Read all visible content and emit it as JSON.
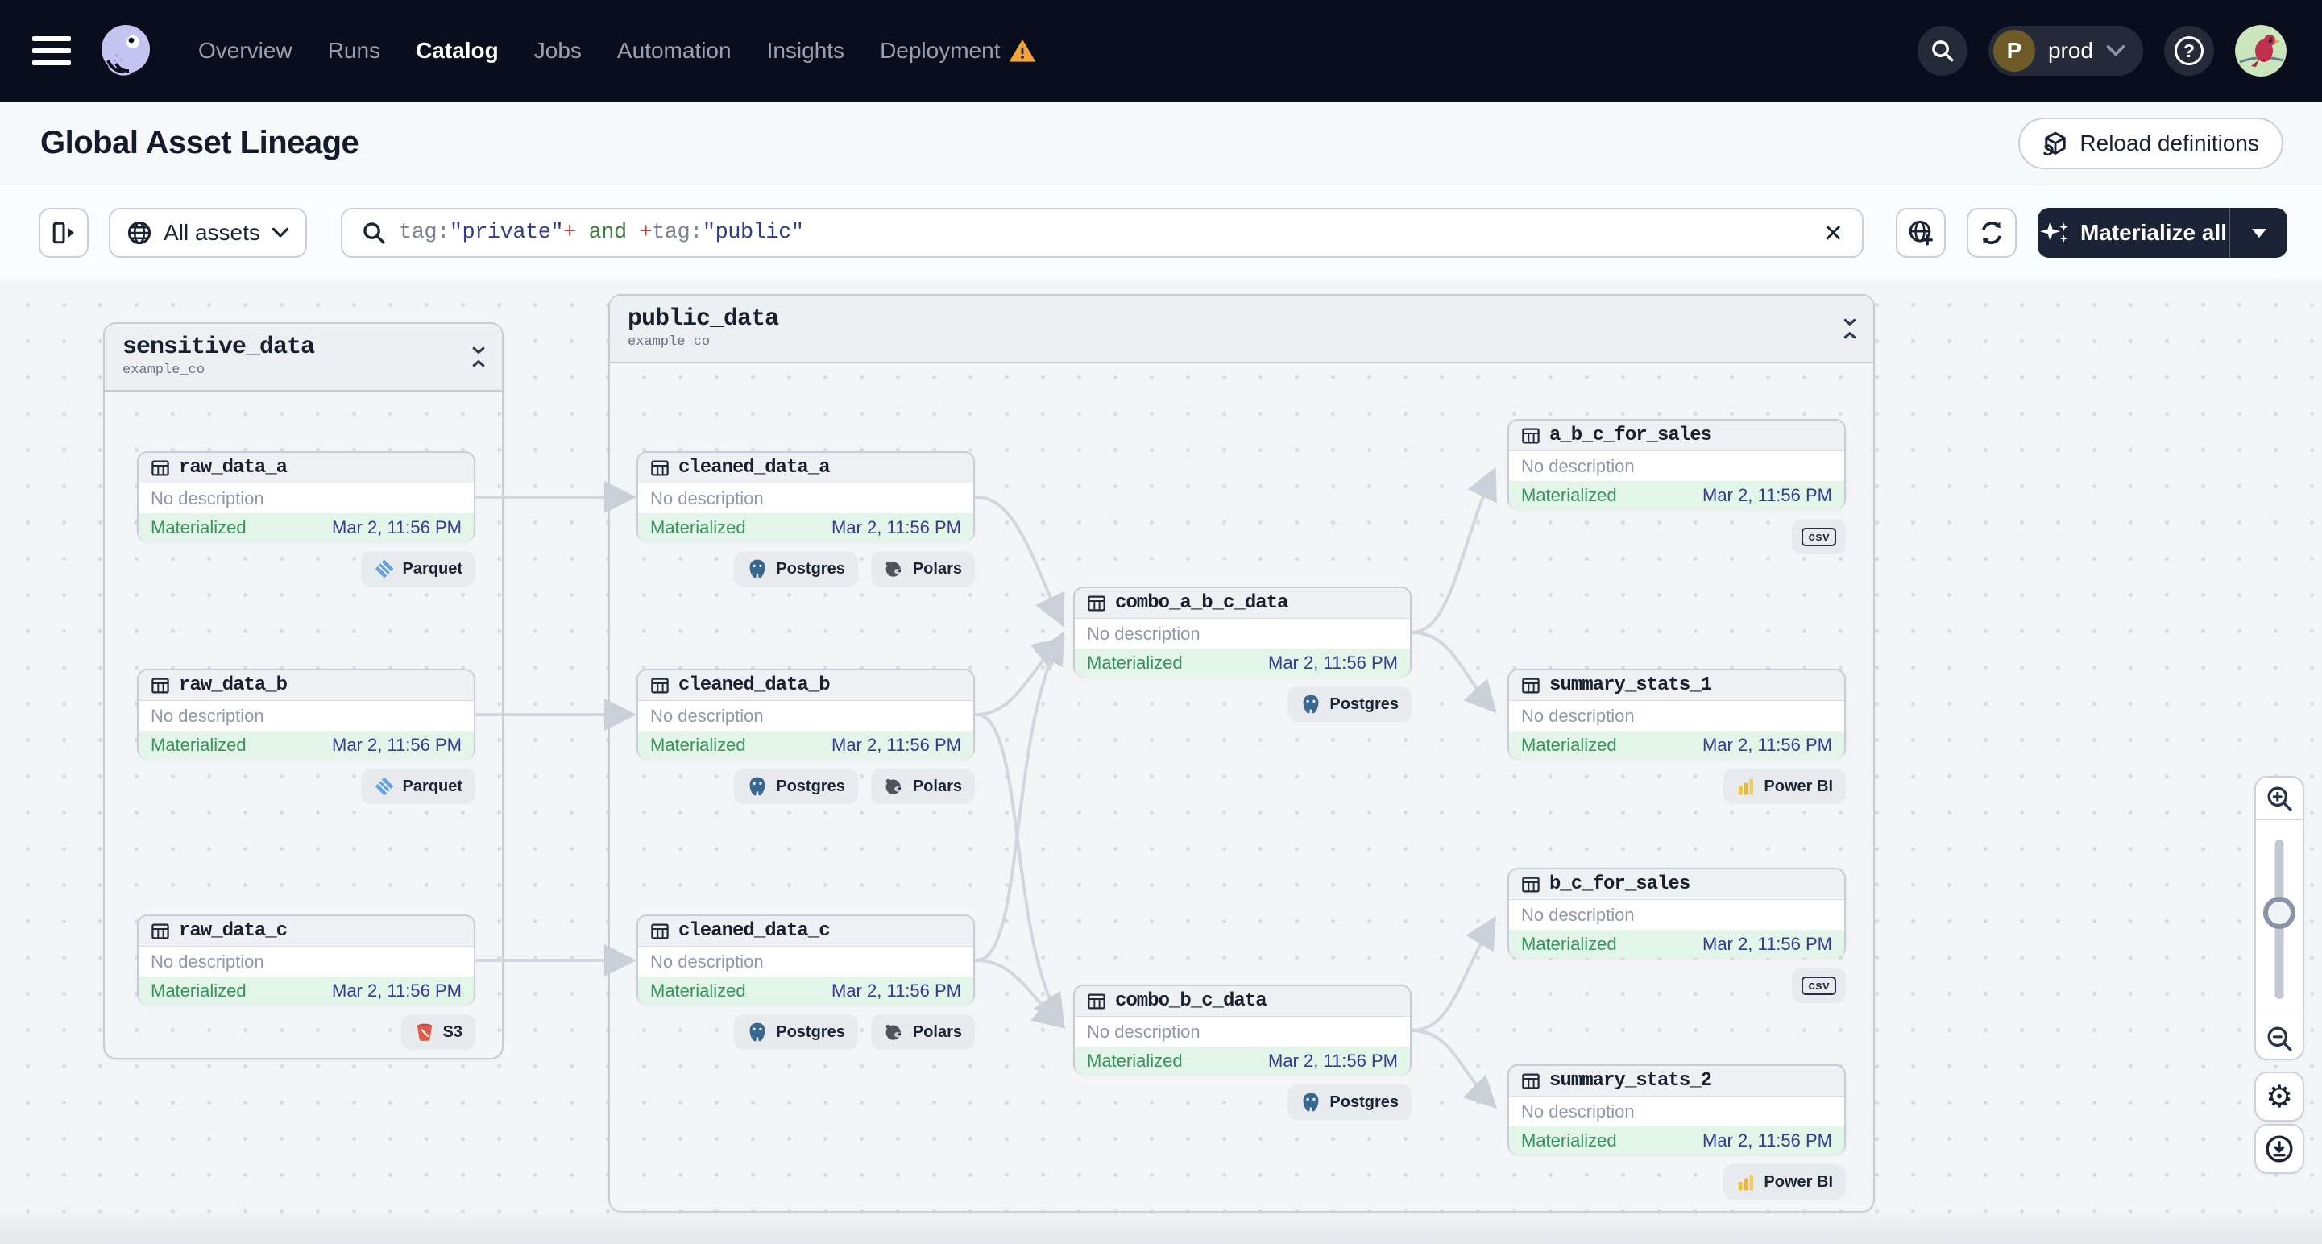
{
  "nav": {
    "items": [
      {
        "label": "Overview"
      },
      {
        "label": "Runs"
      },
      {
        "label": "Catalog"
      },
      {
        "label": "Jobs"
      },
      {
        "label": "Automation"
      },
      {
        "label": "Insights"
      },
      {
        "label": "Deployment"
      }
    ],
    "active": "Catalog",
    "deployment_warning": true,
    "env": {
      "initial": "P",
      "label": "prod"
    },
    "help_glyph": "?"
  },
  "header": {
    "title": "Global Asset Lineage",
    "reload_label": "Reload definitions"
  },
  "toolbar": {
    "scope_label": "All assets",
    "query_parts": [
      {
        "text": "tag:",
        "kind": "key"
      },
      {
        "text": "\"private\"",
        "kind": "value"
      },
      {
        "text": "+",
        "kind": "op"
      },
      {
        "text": " and ",
        "kind": "bool"
      },
      {
        "text": "+",
        "kind": "op"
      },
      {
        "text": "tag:",
        "kind": "key"
      },
      {
        "text": "\"public\"",
        "kind": "value"
      }
    ],
    "clear_glyph": "×",
    "materialize_label": "Materialize all"
  },
  "graph": {
    "groups": [
      {
        "name": "sensitive_data",
        "subtitle": "example_co"
      },
      {
        "name": "public_data",
        "subtitle": "example_co"
      }
    ],
    "assets": [
      {
        "name": "raw_data_a",
        "description": "No description",
        "status": "Materialized",
        "date": "Mar 2, 11:56 PM",
        "tags": [
          "Parquet"
        ]
      },
      {
        "name": "raw_data_b",
        "description": "No description",
        "status": "Materialized",
        "date": "Mar 2, 11:56 PM",
        "tags": [
          "Parquet"
        ]
      },
      {
        "name": "raw_data_c",
        "description": "No description",
        "status": "Materialized",
        "date": "Mar 2, 11:56 PM",
        "tags": [
          "S3"
        ]
      },
      {
        "name": "cleaned_data_a",
        "description": "No description",
        "status": "Materialized",
        "date": "Mar 2, 11:56 PM",
        "tags": [
          "Postgres",
          "Polars"
        ]
      },
      {
        "name": "cleaned_data_b",
        "description": "No description",
        "status": "Materialized",
        "date": "Mar 2, 11:56 PM",
        "tags": [
          "Postgres",
          "Polars"
        ]
      },
      {
        "name": "cleaned_data_c",
        "description": "No description",
        "status": "Materialized",
        "date": "Mar 2, 11:56 PM",
        "tags": [
          "Postgres",
          "Polars"
        ]
      },
      {
        "name": "combo_a_b_c_data",
        "description": "No description",
        "status": "Materialized",
        "date": "Mar 2, 11:56 PM",
        "tags": [
          "Postgres"
        ]
      },
      {
        "name": "combo_b_c_data",
        "description": "No description",
        "status": "Materialized",
        "date": "Mar 2, 11:56 PM",
        "tags": [
          "Postgres"
        ]
      },
      {
        "name": "a_b_c_for_sales",
        "description": "No description",
        "status": "Materialized",
        "date": "Mar 2, 11:56 PM",
        "tags": [
          "csv"
        ]
      },
      {
        "name": "summary_stats_1",
        "description": "No description",
        "status": "Materialized",
        "date": "Mar 2, 11:56 PM",
        "tags": [
          "Power BI"
        ]
      },
      {
        "name": "b_c_for_sales",
        "description": "No description",
        "status": "Materialized",
        "date": "Mar 2, 11:56 PM",
        "tags": [
          "csv"
        ]
      },
      {
        "name": "summary_stats_2",
        "description": "No description",
        "status": "Materialized",
        "date": "Mar 2, 11:56 PM",
        "tags": [
          "Power BI"
        ]
      }
    ],
    "edges": [
      [
        "raw_data_a",
        "cleaned_data_a"
      ],
      [
        "raw_data_b",
        "cleaned_data_b"
      ],
      [
        "raw_data_c",
        "cleaned_data_c"
      ],
      [
        "cleaned_data_a",
        "combo_a_b_c_data"
      ],
      [
        "cleaned_data_b",
        "combo_a_b_c_data"
      ],
      [
        "cleaned_data_c",
        "combo_a_b_c_data"
      ],
      [
        "cleaned_data_b",
        "combo_b_c_data"
      ],
      [
        "cleaned_data_c",
        "combo_b_c_data"
      ],
      [
        "combo_a_b_c_data",
        "a_b_c_for_sales"
      ],
      [
        "combo_a_b_c_data",
        "summary_stats_1"
      ],
      [
        "combo_b_c_data",
        "b_c_for_sales"
      ],
      [
        "combo_b_c_data",
        "summary_stats_2"
      ]
    ]
  },
  "colors": {
    "nav_bg": "#0A0D1C",
    "accent_dark": "#1B2336",
    "status_green": "#35935D",
    "status_green_bg": "#E3F4E9",
    "date_navy": "#303D92",
    "edge_gray": "#D2D6DE",
    "warning_orange": "#F2A33C",
    "parquet_blue": "#67A0E4",
    "postgres_blue": "#39678F",
    "powerbi_yellow": "#EFC244",
    "s3_red": "#DD5A4C"
  }
}
